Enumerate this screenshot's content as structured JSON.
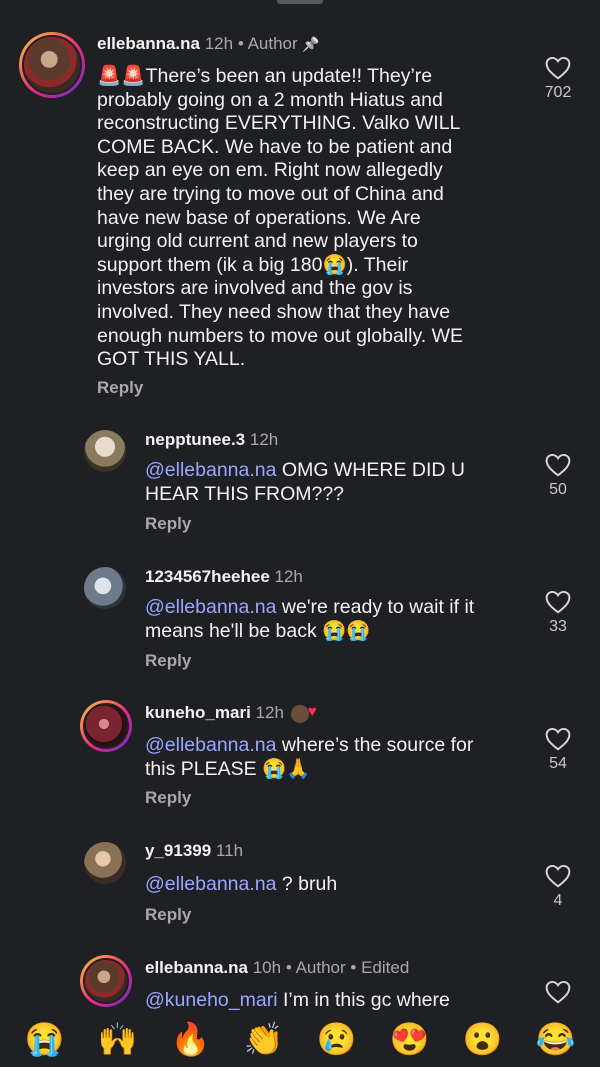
{
  "comments": [
    {
      "username": "ellebanna.na",
      "time": "12h",
      "tag": "• Author",
      "pin": "📌",
      "text_lines": [
        "🚨🚨There’s been an update!! They’re",
        "probably going on a 2 month Hiatus and",
        "reconstructing EVERYTHING. Valko WILL",
        "COME BACK. We have to be patient and",
        "keep an eye on em. Right now allegedly",
        "they are trying to move out of China and",
        "have new base of operations. We Are",
        "urging old current and new players to",
        "support them (ik a big 180😭). Their",
        "investors are involved and the gov is",
        "involved. They need show that they have",
        "enough numbers to move out globally. WE",
        "GOT THIS YALL."
      ],
      "reply": "Reply",
      "likes": "702",
      "avatar_color": "#7a5a3a"
    },
    {
      "username": "nepptunee.3",
      "time": "12h",
      "mention": "@ellebanna.na",
      "line1": " OMG WHERE DID U",
      "line2": "HEAR THIS FROM???",
      "reply": "Reply",
      "likes": "50",
      "avatar_color": "#8a7a60"
    },
    {
      "username": "1234567heehee",
      "time": "12h",
      "mention": "@ellebanna.na",
      "line1": " we're ready to wait if it",
      "line2": "means he'll be back 😭😭",
      "reply": "Reply",
      "likes": "33",
      "avatar_color": "#6d7a8a"
    },
    {
      "username": "kuneho_mari",
      "time": "12h",
      "mention": "@ellebanna.na",
      "line1": " where’s the source for",
      "line2": "this PLEASE 😭🙏",
      "reply": "Reply",
      "likes": "54",
      "avatar_color": "#7a2430"
    },
    {
      "username": "y_91399",
      "time": "11h",
      "mention": "@ellebanna.na",
      "line1": " ?  bruh",
      "reply": "Reply",
      "likes": "4",
      "avatar_color": "#8a7055"
    },
    {
      "username": "ellebanna.na",
      "time": "10h",
      "tag": "• Author",
      "edited": "• Edited",
      "mention": "@kuneho_mari",
      "line1": " I’m in this gc where",
      "avatar_color": "#7a5a3a"
    }
  ],
  "emoji_bar": [
    "😭",
    "🙌",
    "🔥",
    "👏",
    "😢",
    "😍",
    "😮",
    "😂"
  ],
  "colors": {
    "background": "#1f2024",
    "mention": "#9aa7ff",
    "secondary": "#a8a8ad"
  }
}
